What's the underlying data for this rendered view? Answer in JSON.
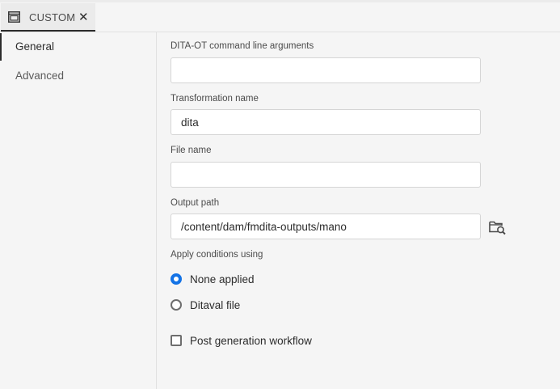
{
  "tab": {
    "icon": "window-icon",
    "label": "CUSTOM",
    "close_glyph": "✕"
  },
  "sidebar": {
    "items": [
      {
        "label": "General",
        "active": true
      },
      {
        "label": "Advanced",
        "active": false
      }
    ]
  },
  "form": {
    "cmd_args": {
      "label": "DITA-OT command line arguments",
      "value": ""
    },
    "transformation_name": {
      "label": "Transformation name",
      "value": "dita"
    },
    "file_name": {
      "label": "File name",
      "value": ""
    },
    "output_path": {
      "label": "Output path",
      "value": "/content/dam/fmdita-outputs/mano",
      "browse_icon": "folder-search-icon"
    },
    "conditions": {
      "label": "Apply conditions using",
      "options": [
        {
          "label": "None applied",
          "selected": true
        },
        {
          "label": "Ditaval file",
          "selected": false
        }
      ]
    },
    "post_generation": {
      "label": "Post generation workflow",
      "checked": false
    }
  },
  "colors": {
    "accent": "#1473e6",
    "background": "#f5f5f5",
    "input_bg": "#ffffff"
  }
}
